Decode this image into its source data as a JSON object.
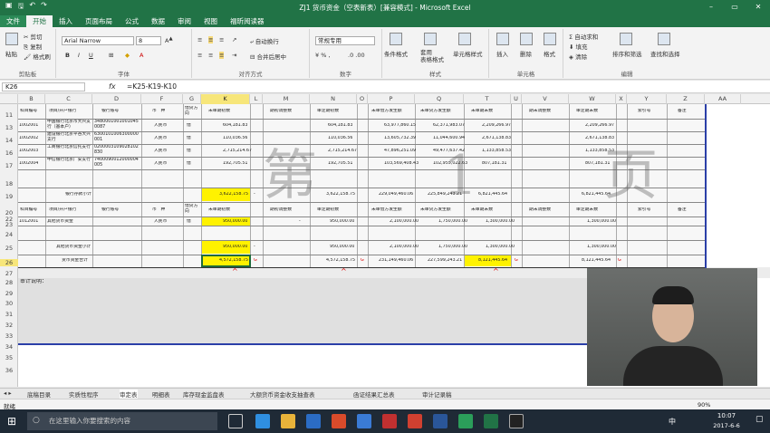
{
  "title_bar": {
    "title": "ZJ1 货币资金（空表新表）[兼容模式] - Microsoft Excel",
    "win_min": "–",
    "win_restore": "▭",
    "win_close": "✕"
  },
  "tabs": [
    "文件",
    "开始",
    "插入",
    "页面布局",
    "公式",
    "数据",
    "审阅",
    "视图",
    "福昕阅读器"
  ],
  "ribbon": {
    "paste": "粘贴",
    "cut": "剪切",
    "copy": "复制",
    "format_painter": "格式刷",
    "clipboard_group": "剪贴板",
    "font_name": "Arial Narrow",
    "font_size": "8",
    "font_group": "字体",
    "wrap_text": "自动换行",
    "merge_center": "合并后居中",
    "align_group": "对齐方式",
    "number_format": "常规专用",
    "number_group": "数字",
    "cond_format": "条件格式",
    "format_table": "套用\n表格格式",
    "cell_styles": "单元格样式",
    "styles_group": "样式",
    "insert": "插入",
    "delete": "删除",
    "format": "格式",
    "cells_group": "单元格",
    "autosum": "自动求和",
    "fill": "填充",
    "clear": "清除",
    "sort_filter": "排序和筛选",
    "find_select": "查找和选择",
    "editing_group": "编辑"
  },
  "formula_bar": {
    "name_box": "K26",
    "fx": "fx",
    "formula": "=K25-K19-K10"
  },
  "columns": [
    "B",
    "C",
    "D",
    "F",
    "G",
    "K",
    "L",
    "M",
    "N",
    "O",
    "P",
    "Q",
    "T",
    "U",
    "V",
    "W",
    "X",
    "Y",
    "Z",
    "AA"
  ],
  "rows": [
    "11",
    "13",
    "14",
    "16",
    "17",
    "18",
    "19",
    "20",
    "22",
    "23",
    "24",
    "25",
    "26",
    "27",
    "28",
    "29",
    "30",
    "31",
    "32",
    "33",
    "34",
    "35",
    "36"
  ],
  "table": {
    "headers": [
      "科目编号",
      "项目/开户银行",
      "银行账号",
      "币　种",
      "借贷方向",
      "未审期初数",
      "期初调整数",
      "审定期初数",
      "未审借方发生额",
      "未审贷方发生额",
      "未审期末数",
      "期末调整数",
      "审定期末数",
      "索引号",
      "备注"
    ],
    "bank_rows": [
      {
        "code": "1002001",
        "name": "中国银行北京市大兴支行（基本户）",
        "acct": "34800010010010450087",
        "cur": "人民币",
        "dir": "借",
        "k": "604,181.83",
        "n": "604,181.83",
        "p": "63,977,860.15",
        "q": "62,371,983.07",
        "t": "2,209,266.97",
        "w": "2,209,266.97"
      },
      {
        "code": "1002002",
        "name": "建设银行北京平谷大兴支行",
        "acct": "6300101006300000001",
        "cur": "人民币",
        "dir": "借",
        "k": "110,036.56",
        "n": "110,036.56",
        "p": "13,605,732.39",
        "q": "11,044,600.94",
        "t": "2,671,138.83",
        "w": "2,671,138.83"
      },
      {
        "code": "1002003",
        "name": "工商银行北京信托支行",
        "acct": "0200003109028102830",
        "cur": "人民币",
        "dir": "借",
        "k": "2,715,214.67",
        "n": "2,715,214.67",
        "p": "47,896,251.09",
        "q": "49,477,637.42",
        "t": "1,133,858.53",
        "w": "1,133,858.53"
      },
      {
        "code": "1002004",
        "name": "中信银行北京广安支行",
        "acct": "7400090012000004005",
        "cur": "人民币",
        "dir": "借",
        "k": "192,705.51",
        "n": "192,705.51",
        "p": "103,569,408.43",
        "q": "102,955,022.63",
        "t": "807,181.31",
        "w": "807,181.31"
      }
    ],
    "bank_subtotal": {
      "label": "银行存款小计",
      "k": "3,622,158.75",
      "dash": "-",
      "n": "3,622,158.75",
      "p": "229,049,460.06",
      "q": "225,849,243.21",
      "t": "6,821,445.64",
      "w": "6,821,445.64"
    },
    "other_row": {
      "code": "1012001",
      "name": "其他货币资金",
      "cur": "人民币",
      "dir": "借",
      "k": "950,000.00",
      "dash": "-",
      "n": "950,000.00",
      "p": "2,100,000.00",
      "q": "1,750,000.00",
      "t": "1,300,000.00",
      "w": "1,300,000.00"
    },
    "other_subtotal": {
      "label": "其他货币资金小计",
      "k": "950,000.00",
      "dash": "-",
      "n": "950,000.00",
      "p": "2,100,000.00",
      "q": "1,750,000.00",
      "t": "1,300,000.00",
      "w": "1,300,000.00"
    },
    "total": {
      "label": "货币资金合计",
      "k": "4,572,158.75",
      "n": "4,572,158.75",
      "p": "231,149,460.06",
      "q": "227,599,243.21",
      "t": "8,121,445.64",
      "w": "8,121,445.64",
      "mark": "G"
    },
    "audit_note": "审计说明："
  },
  "watermark": "第 1 页",
  "sheet_tabs": [
    "底稿目录",
    "实质性程序",
    "审定表",
    "明细表",
    "库存现金监盘表",
    "大额货币资金收支抽查表",
    "函证结果汇总表",
    "审计记录稿"
  ],
  "status": {
    "left": "就绪",
    "zoom": "90%"
  },
  "taskbar": {
    "search": "在这里输入你要搜索的内容",
    "time": "10:07",
    "date": "2017-6-6",
    "ime": "中"
  }
}
